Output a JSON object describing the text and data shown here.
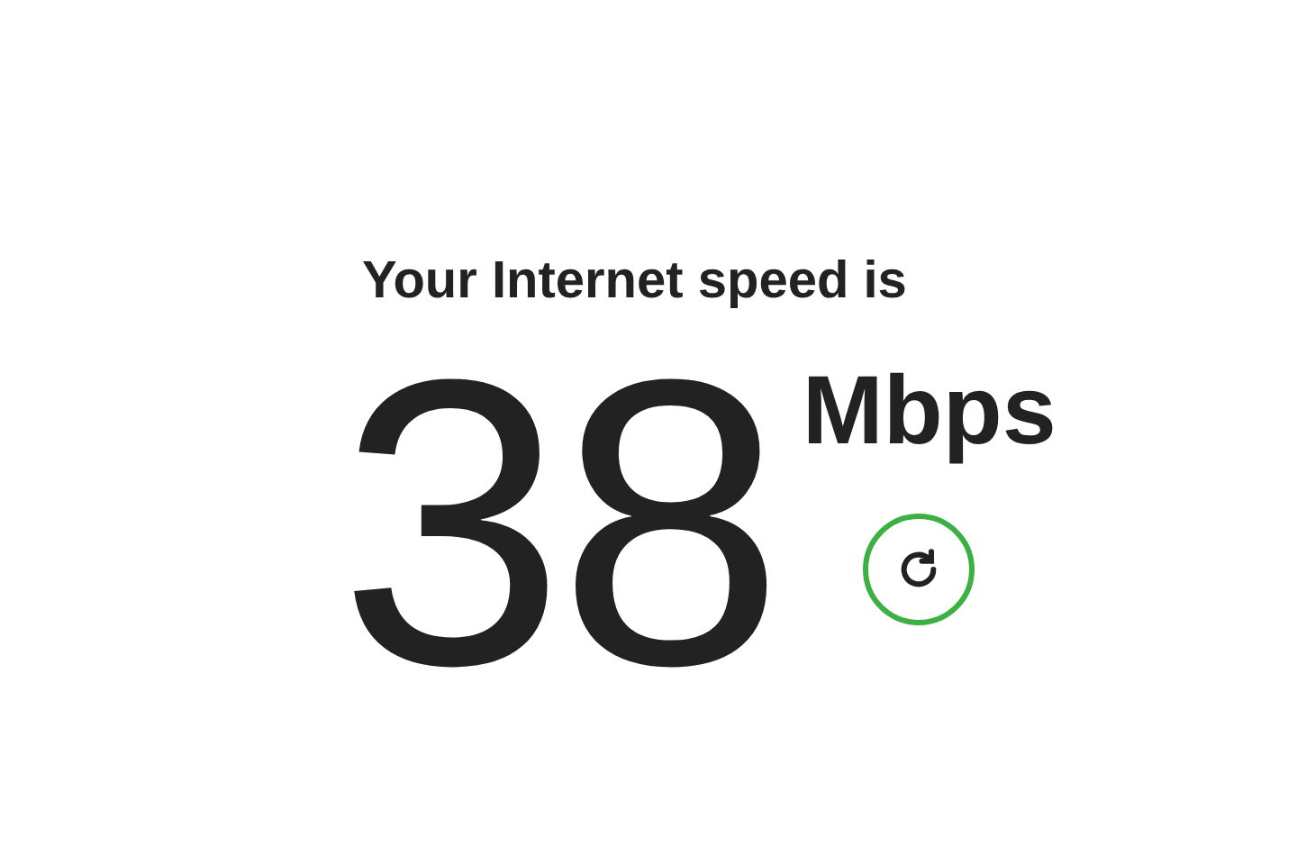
{
  "heading": "Your Internet speed is",
  "speed": {
    "value": "38",
    "unit": "Mbps"
  },
  "refresh_button": {
    "kind": "refresh"
  }
}
